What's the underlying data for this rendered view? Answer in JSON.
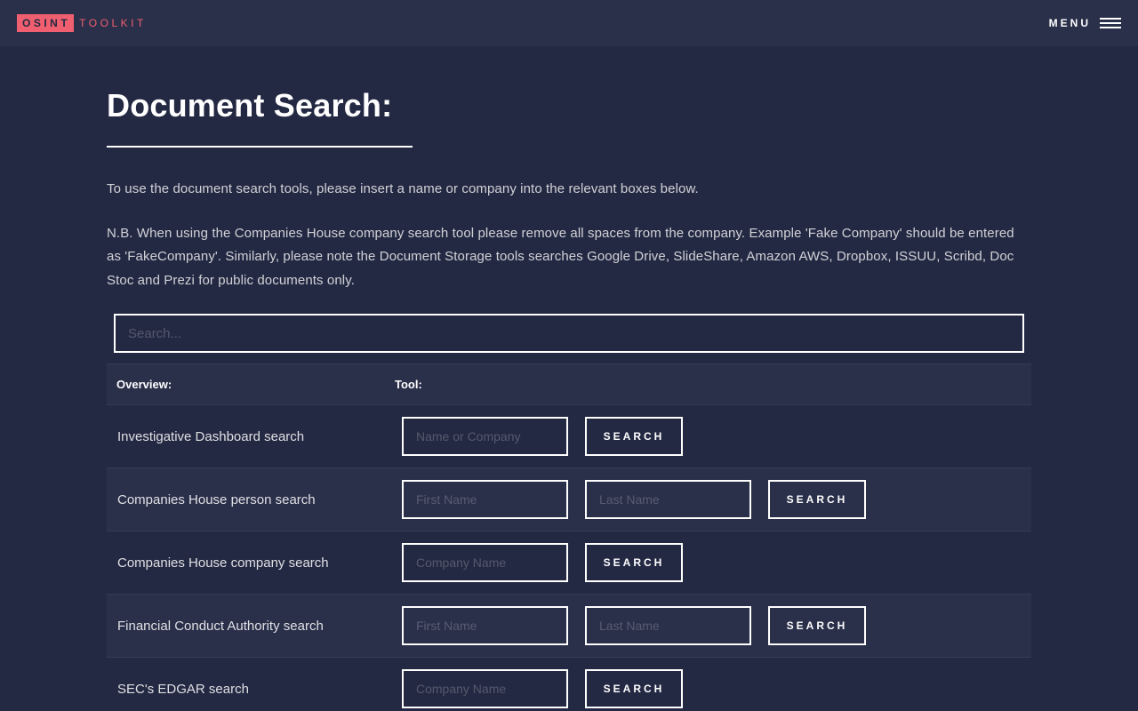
{
  "header": {
    "logo_part1": "OSINT",
    "logo_part2": "TOOLKIT",
    "menu_label": "MENU",
    "accent_color": "#f05f6f"
  },
  "page": {
    "title": "Document Search:",
    "intro": "To use the document search tools, please insert a name or company into the relevant boxes below.",
    "note": "N.B. When using the Companies House company search tool please remove all spaces from the company. Example 'Fake Company' should be entered as 'FakeCompany'. Similarly, please note the Document Storage tools searches Google Drive, SlideShare, Amazon AWS, Dropbox, ISSUU, Scribd, Doc Stoc and Prezi for public documents only."
  },
  "search": {
    "placeholder": "Search..."
  },
  "table": {
    "headers": {
      "overview": "Overview:",
      "tool": "Tool:"
    },
    "rows": [
      {
        "overview": "Investigative Dashboard search",
        "input1": "Name or Company",
        "button": "SEARCH"
      },
      {
        "overview": "Companies House person search",
        "input1": "First Name",
        "input2": "Last Name",
        "button": "SEARCH"
      },
      {
        "overview": "Companies House company search",
        "input1": "Company Name",
        "button": "SEARCH"
      },
      {
        "overview": "Financial Conduct Authority search",
        "input1": "First Name",
        "input2": "Last Name",
        "button": "SEARCH"
      },
      {
        "overview": "SEC's EDGAR search",
        "input1": "Company Name",
        "button": "SEARCH"
      }
    ]
  }
}
